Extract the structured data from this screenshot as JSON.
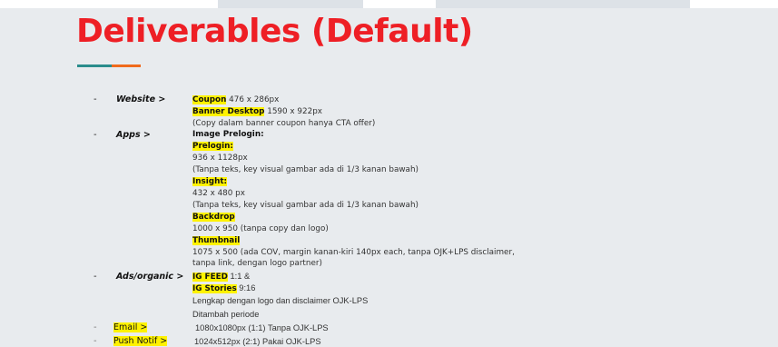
{
  "slide": {
    "title": "Deliverables (Default)",
    "accent_colors": [
      "#2a8c8c",
      "#f06a1c"
    ],
    "title_color": "#ee1f25",
    "highlight_color": "#fff200"
  },
  "list": {
    "dash": "-",
    "website": {
      "label": "Website >",
      "coupon_label": "Coupon",
      "coupon_size": " 476 x 286px",
      "banner_label": "Banner Desktop",
      "banner_size": " 1590 x 922px",
      "note": "(Copy dalam banner coupon hanya CTA offer)"
    },
    "apps": {
      "label": "Apps >",
      "image_prelogin": "Image Prelogin:",
      "prelogin_label": "Prelogin:",
      "prelogin_size": "936 x 1128px",
      "prelogin_note": "(Tanpa teks, key visual gambar ada di 1/3 kanan bawah)",
      "insight_label": "Insight:",
      "insight_size": "432 x 480 px",
      "insight_note": "(Tanpa teks, key visual gambar ada di 1/3 kanan bawah)",
      "backdrop_label": "Backdrop",
      "backdrop_size": "1000 x 950 (tanpa copy dan logo)",
      "thumbnail_label": "Thumbnail",
      "thumbnail_line1": "1075 x 500 (ada COV, margin kanan-kiri 140px each, tanpa OJK+LPS disclaimer,",
      "thumbnail_line2": "tanpa link, dengan logo partner)"
    },
    "ads": {
      "label": "Ads/organic >",
      "igfeed_label": "IG FEED",
      "igfeed_ratio": " 1:1 &",
      "igstories_label": "IG Stories",
      "igstories_ratio": " 9:16",
      "note1": "Lengkap dengan logo dan disclaimer OJK-LPS",
      "note2": "Ditambah periode"
    },
    "email": {
      "label": "Email >",
      "spec": "1080x1080px (1:1) Tanpa OJK-LPS"
    },
    "push": {
      "label": "Push Notif >",
      "spec": "1024x512px (2:1) Pakai OJK-LPS"
    }
  }
}
